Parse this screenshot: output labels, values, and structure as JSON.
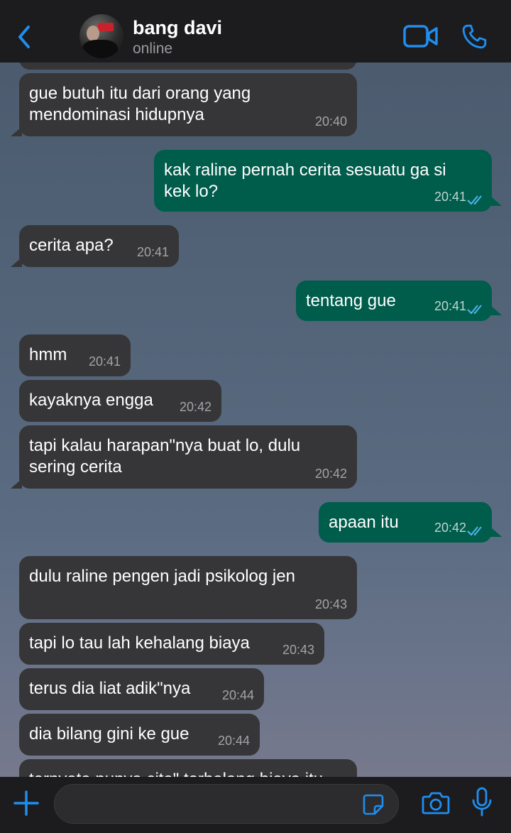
{
  "contact": {
    "name": "bang davi",
    "status": "online"
  },
  "icons": {
    "back": "chevron-left-icon",
    "video": "video-camera-icon",
    "call": "phone-icon",
    "plus": "plus-icon",
    "sticker": "sticker-icon",
    "camera": "camera-icon",
    "mic": "microphone-icon"
  },
  "colors": {
    "accent": "#1e8ef0",
    "incoming_bubble": "#363638",
    "outgoing_bubble": "#005c4b",
    "read_ticks": "#4fb6ec"
  },
  "messages": [
    {
      "direction": "in",
      "text": "",
      "time": ""
    },
    {
      "direction": "in",
      "text": "gue butuh itu dari orang yang\nmendominasi hidupnya",
      "time": "20:40"
    },
    {
      "direction": "out",
      "text": "kak raline pernah cerita sesuatu ga si\nkek lo?",
      "time": "20:41",
      "status": "read"
    },
    {
      "direction": "in",
      "text": "cerita apa?",
      "time": "20:41"
    },
    {
      "direction": "out",
      "text": "tentang gue",
      "time": "20:41",
      "status": "read"
    },
    {
      "direction": "in",
      "text": "hmm",
      "time": "20:41"
    },
    {
      "direction": "in",
      "text": "kayaknya engga",
      "time": "20:42"
    },
    {
      "direction": "in",
      "text": "tapi kalau harapan\"nya buat lo, dulu\nsering cerita",
      "time": "20:42"
    },
    {
      "direction": "out",
      "text": "apaan itu",
      "time": "20:42",
      "status": "read"
    },
    {
      "direction": "in",
      "text": "dulu raline pengen jadi psikolog jen",
      "time": "20:43"
    },
    {
      "direction": "in",
      "text": "tapi lo tau lah kehalang biaya",
      "time": "20:43"
    },
    {
      "direction": "in",
      "text": "terus dia liat adik\"nya",
      "time": "20:44"
    },
    {
      "direction": "in",
      "text": "dia bilang gini ke gue",
      "time": "20:44"
    },
    {
      "direction": "in",
      "text": "ternyata punya cita\" terhalang biaya itu",
      "time": ""
    }
  ],
  "composer": {
    "value": "",
    "placeholder": ""
  }
}
